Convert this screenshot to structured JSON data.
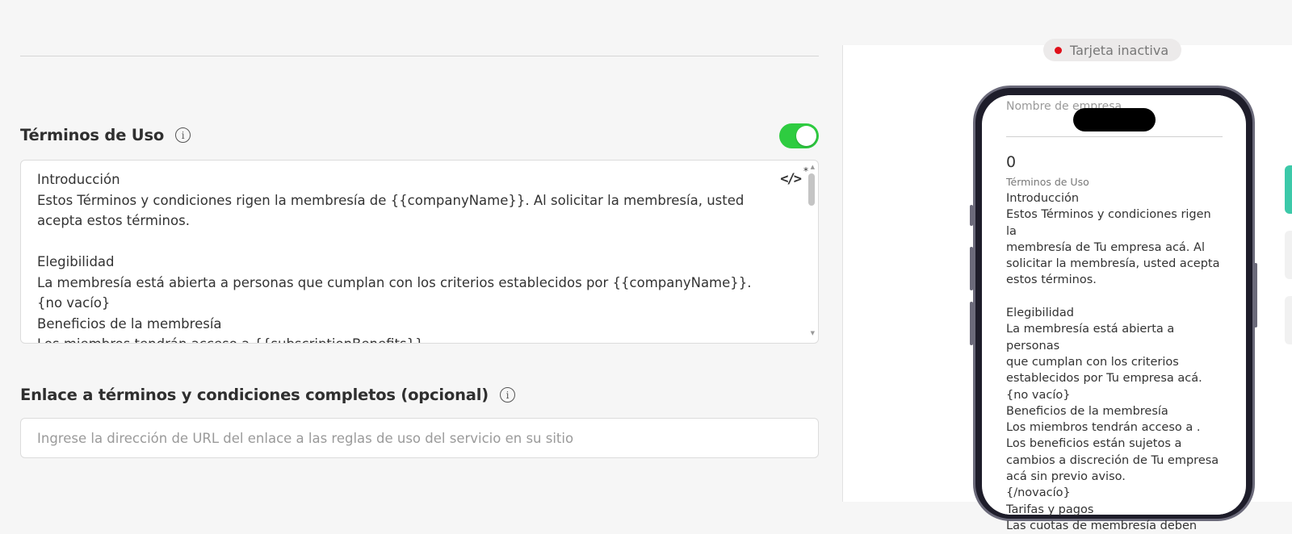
{
  "editor": {
    "terms_title": "Términos de Uso",
    "terms_enabled": true,
    "terms_body": "Introducción\nEstos Términos y condiciones rigen la membresía de {{companyName}}. Al solicitar la membresía, usted\nacepta estos términos.\n\nElegibilidad\nLa membresía está abierta a personas que cumplan con los criterios establecidos por {{companyName}}.\n{no vacío}\nBeneficios de la membresía\nLos miembros tendrán acceso a {{subscriptionBenefits}}",
    "code_icon": "</>",
    "code_star": "*",
    "link_title": "Enlace a términos y condiciones completos (opcional)",
    "link_placeholder": "Ingrese la dirección de URL del enlace a las reglas de uso del servicio en su sitio"
  },
  "preview": {
    "status": "Tarjeta inactiva",
    "status_color": "#e0101a",
    "company_name": "Nombre de empresa",
    "counter": "0",
    "terms_label": "Términos de Uso",
    "terms_body": "Introducción\nEstos Términos y condiciones rigen la\nmembresía de Tu empresa acá. Al\nsolicitar la membresía, usted acepta\nestos términos.\n\nElegibilidad\nLa membresía está abierta a personas\nque cumplan con los criterios\nestablecidos por Tu empresa acá.\n{no vacío}\nBeneficios de la membresía\nLos miembros tendrán acceso a .\nLos beneficios están sujetos a\ncambios a discreción de Tu empresa\nacá sin previo aviso.\n{/novacío}\nTarifas y pagos\nLas cuotas de membresía deben"
  },
  "colors": {
    "toggle_on": "#2ecc40",
    "accent_tab": "#3cc9a9"
  }
}
